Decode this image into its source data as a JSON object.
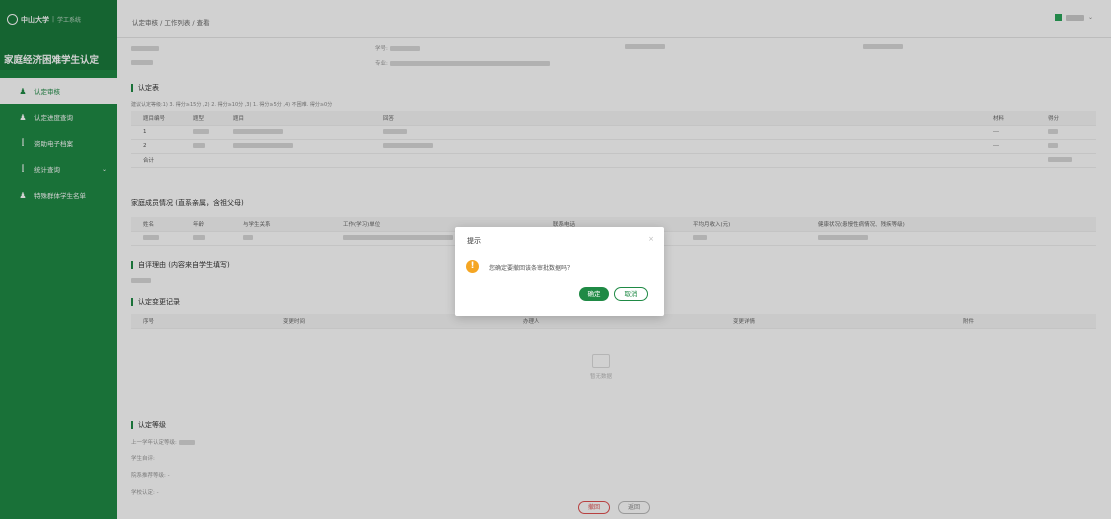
{
  "sidebar": {
    "logo_text": "中山大学",
    "logo_sub": "学工系统",
    "system_title": "家庭经济困难学生认定",
    "items": [
      {
        "label": "认定审核",
        "active": true
      },
      {
        "label": "认定进度查询",
        "active": false
      },
      {
        "label": "资助电子档案",
        "active": false
      },
      {
        "label": "统计查询",
        "active": false,
        "has_submenu": true
      },
      {
        "label": "特殊群体学生名单",
        "active": false
      }
    ]
  },
  "header": {
    "breadcrumb": "认定审核 / 工作列表 / 查看"
  },
  "student": {
    "student_id_label": "学号:",
    "major_label": "专业:"
  },
  "sections": {
    "assessment": "认定表",
    "assessment_note": "建议认定等级:1) 3. 得分≥15分 ,2) 2. 得分≥10分 ,3) 1. 得分≥5分 ,4) 不困难. 得分≥0分",
    "family": "家庭成员情况 (直系亲属，含祖父母)",
    "self_eval": "自评理由 (内容来自学生填写)",
    "change_log": "认定变更记录",
    "level": "认定等级"
  },
  "assessment_table": {
    "headers": [
      "题目编号",
      "题型",
      "题目",
      "回答",
      "材料",
      "得分"
    ],
    "rows": [
      [
        "1",
        "",
        "",
        "",
        "---",
        ""
      ],
      [
        "2",
        "",
        "",
        "",
        "---",
        ""
      ]
    ],
    "total_label": "合计"
  },
  "family_table": {
    "headers": [
      "姓名",
      "年龄",
      "与学生关系",
      "工作(学习)单位",
      "联系电话",
      "平均月收入(元)",
      "健康状况(患慢性病情况、残疾等级)"
    ]
  },
  "change_table": {
    "headers": [
      "序号",
      "变更时间",
      "办理人",
      "变更详情",
      "附件"
    ],
    "empty_text": "暂无数据"
  },
  "level_info": {
    "prev_label": "上一学年认定等级: ",
    "student_eval": "学生自评: ",
    "dept_label": "院系推荐等级: -",
    "school_label": "学校认定: -"
  },
  "footer": {
    "withdraw": "撤回",
    "back": "返回"
  },
  "dialog": {
    "title": "提示",
    "message": "您确定要撤回该条审批数据吗？",
    "confirm": "确定",
    "cancel": "取消"
  },
  "colors": {
    "brand": "#1f8a45",
    "warning": "#f5a623",
    "danger": "#e05050"
  }
}
